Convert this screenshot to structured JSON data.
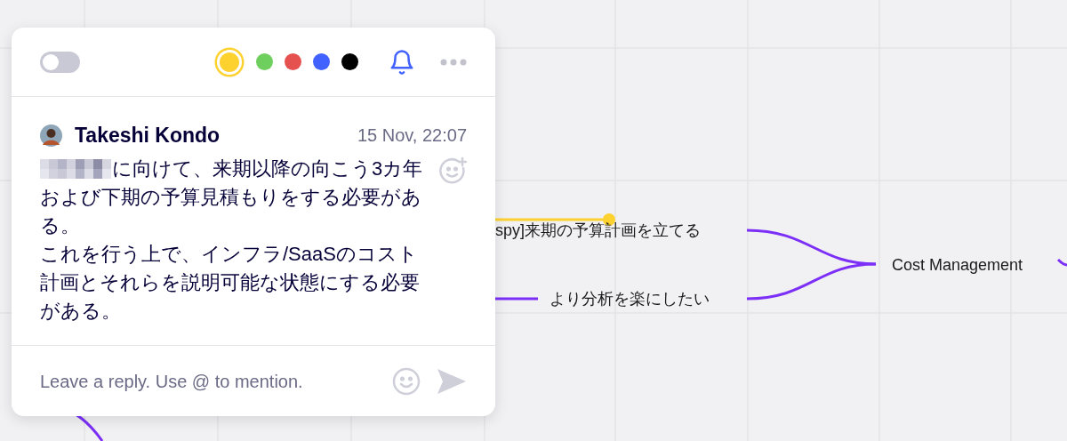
{
  "canvas": {
    "nodes": [
      {
        "label": "spy]来期の予算計画を立てる"
      },
      {
        "label": "より分析を楽にしたい"
      },
      {
        "label": "Cost Management"
      }
    ]
  },
  "comment_card": {
    "toggle": {
      "on": false
    },
    "colors": [
      {
        "color": "#fdd12e",
        "selected": true
      },
      {
        "color": "#6fcf5e",
        "selected": false
      },
      {
        "color": "#e5514f",
        "selected": false
      },
      {
        "color": "#4262ff",
        "selected": false
      },
      {
        "color": "#000000",
        "selected": false
      }
    ],
    "notifications": {
      "on": true
    },
    "author": "Takeshi Kondo",
    "time": "15 Nov, 22:07",
    "redacted": true,
    "body": [
      "に向けて、来期以降の向こう3カ年および下期の予算見積もりをする必要がある。",
      "これを行う上で、インフラ/SaaSのコスト計画とそれらを説明可能な状態にする必要がある。"
    ],
    "reply": {
      "placeholder": "Leave a reply. Use @ to mention."
    }
  }
}
